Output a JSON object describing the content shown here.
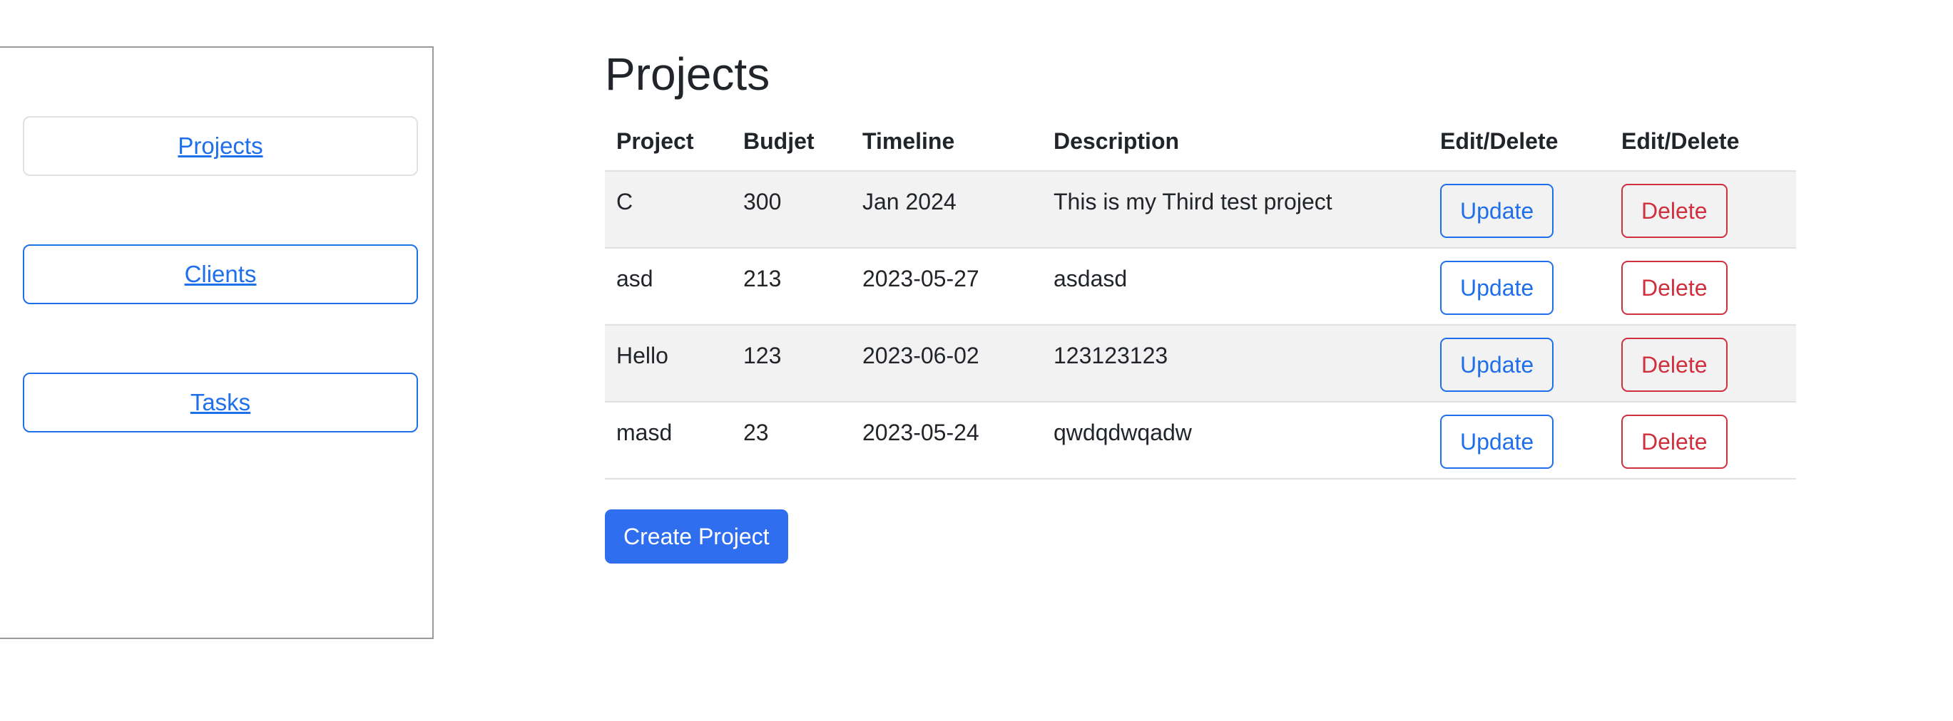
{
  "sidebar": {
    "items": [
      {
        "label": "Projects"
      },
      {
        "label": "Clients"
      },
      {
        "label": "Tasks"
      }
    ]
  },
  "page": {
    "title": "Projects"
  },
  "table": {
    "headers": [
      "Project",
      "Budjet",
      "Timeline",
      "Description",
      "Edit/Delete",
      "Edit/Delete"
    ],
    "rows": [
      {
        "project": "C",
        "budget": "300",
        "timeline": "Jan 2024",
        "description": "This is my Third test project",
        "update_label": "Update",
        "delete_label": "Delete"
      },
      {
        "project": "asd",
        "budget": "213",
        "timeline": "2023-05-27",
        "description": "asdasd",
        "update_label": "Update",
        "delete_label": "Delete"
      },
      {
        "project": "Hello",
        "budget": "123",
        "timeline": "2023-06-02",
        "description": "123123123",
        "update_label": "Update",
        "delete_label": "Delete"
      },
      {
        "project": "masd",
        "budget": "23",
        "timeline": "2023-05-24",
        "description": "qwdqdwqadw",
        "update_label": "Update",
        "delete_label": "Delete"
      }
    ]
  },
  "actions": {
    "create_label": "Create Project"
  },
  "colors": {
    "primary": "#1f6feb",
    "primary_fill": "#2f6fef",
    "danger": "#d02f3d",
    "stripe": "#f2f2f2",
    "border": "#dee2e6"
  }
}
